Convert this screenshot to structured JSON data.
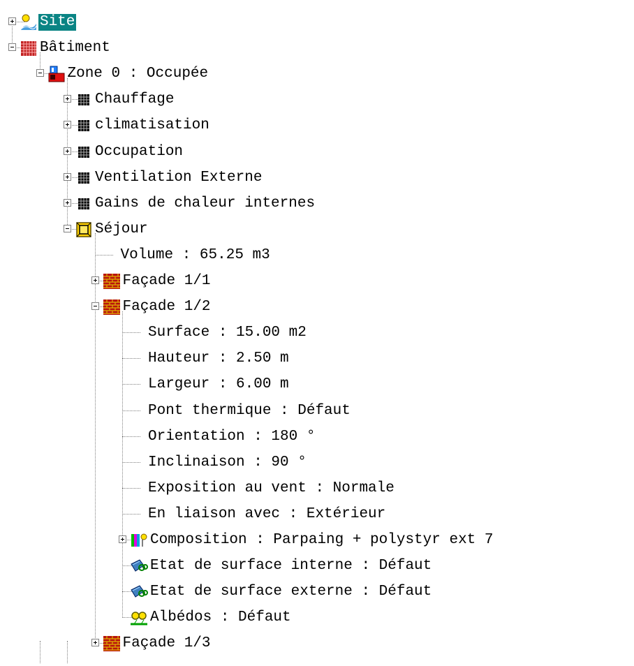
{
  "tree": [
    {
      "id": "site",
      "depth": 0,
      "expander": "plus",
      "icon": "site-icon",
      "label": "Site",
      "selected": true
    },
    {
      "id": "batiment",
      "depth": 0,
      "expander": "minus",
      "icon": "building-icon",
      "label": "Bâtiment"
    },
    {
      "id": "zone",
      "depth": 1,
      "expander": "minus",
      "icon": "zone-icon",
      "label": "Zone 0 : Occupée"
    },
    {
      "id": "chauffage",
      "depth": 2,
      "expander": "plus",
      "icon": "grid-icon",
      "label": "Chauffage"
    },
    {
      "id": "climatisation",
      "depth": 2,
      "expander": "plus",
      "icon": "grid-icon",
      "label": "climatisation"
    },
    {
      "id": "occupation",
      "depth": 2,
      "expander": "plus",
      "icon": "grid-icon",
      "label": "Occupation"
    },
    {
      "id": "ventilation",
      "depth": 2,
      "expander": "plus",
      "icon": "grid-icon",
      "label": "Ventilation Externe"
    },
    {
      "id": "gains",
      "depth": 2,
      "expander": "plus",
      "icon": "grid-icon",
      "label": "Gains de chaleur internes"
    },
    {
      "id": "sejour",
      "depth": 2,
      "expander": "minus",
      "icon": "room-icon",
      "label": "Séjour"
    },
    {
      "id": "volume",
      "depth": 3,
      "expander": "none",
      "icon": "none",
      "label": "Volume : 65.25 m3"
    },
    {
      "id": "facade11",
      "depth": 3,
      "expander": "plus",
      "icon": "brick-wall-icon",
      "label": "Façade 1/1"
    },
    {
      "id": "facade12",
      "depth": 3,
      "expander": "minus",
      "icon": "brick-wall-icon",
      "label": "Façade 1/2"
    },
    {
      "id": "surface",
      "depth": 4,
      "expander": "none",
      "icon": "none",
      "label": "Surface : 15.00 m2"
    },
    {
      "id": "hauteur",
      "depth": 4,
      "expander": "none",
      "icon": "none",
      "label": "Hauteur : 2.50 m"
    },
    {
      "id": "largeur",
      "depth": 4,
      "expander": "none",
      "icon": "none",
      "label": "Largeur : 6.00 m"
    },
    {
      "id": "pont",
      "depth": 4,
      "expander": "none",
      "icon": "none",
      "label": "Pont thermique : Défaut"
    },
    {
      "id": "orientation",
      "depth": 4,
      "expander": "none",
      "icon": "none",
      "label": "Orientation : 180 °"
    },
    {
      "id": "inclinaison",
      "depth": 4,
      "expander": "none",
      "icon": "none",
      "label": "Inclinaison : 90 °"
    },
    {
      "id": "exposition",
      "depth": 4,
      "expander": "none",
      "icon": "none",
      "label": "Exposition au vent : Normale"
    },
    {
      "id": "liaison",
      "depth": 4,
      "expander": "none",
      "icon": "none",
      "label": "En liaison avec : Extérieur"
    },
    {
      "id": "composition",
      "depth": 4,
      "expander": "plus",
      "icon": "layers-icon",
      "label": "Composition : Parpaing + polystyr ext 7"
    },
    {
      "id": "etat-int",
      "depth": 4,
      "expander": "none",
      "icon": "surface-state-icon",
      "label": "Etat de surface interne : Défaut"
    },
    {
      "id": "etat-ext",
      "depth": 4,
      "expander": "none",
      "icon": "surface-state-icon",
      "label": "Etat de surface externe : Défaut"
    },
    {
      "id": "albedos",
      "depth": 4,
      "expander": "none",
      "icon": "albedo-icon",
      "label": "Albédos : Défaut"
    },
    {
      "id": "facade13",
      "depth": 3,
      "expander": "plus",
      "icon": "brick-wall-icon",
      "label": "Façade 1/3"
    }
  ],
  "colors": {
    "selection": "#0a8484",
    "brick": "#b8140f",
    "mortar": "#e0b000"
  }
}
